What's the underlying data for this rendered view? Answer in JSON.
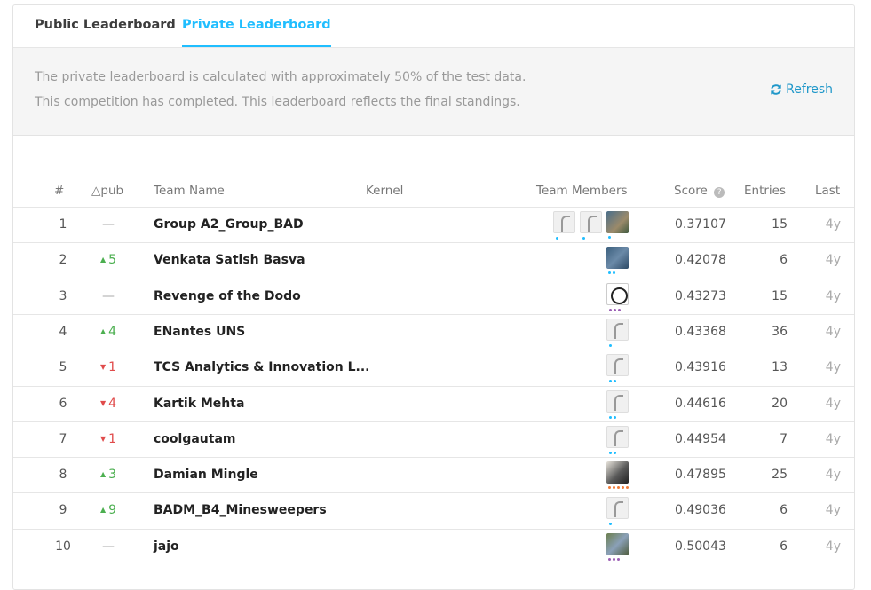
{
  "tabs": {
    "public": "Public Leaderboard",
    "private": "Private Leaderboard"
  },
  "notice": {
    "line1": "The private leaderboard is calculated with approximately 50% of the test data.",
    "line2": "This competition has completed. This leaderboard reflects the final standings.",
    "refresh": "Refresh"
  },
  "columns": {
    "rank": "#",
    "delta": "△pub",
    "team": "Team Name",
    "kernel": "Kernel",
    "members": "Team Members",
    "score": "Score",
    "entries": "Entries",
    "last": "Last"
  },
  "rows": [
    {
      "rank": "1",
      "delta": "—",
      "dir": "none",
      "team": "Group A2_Group_BAD",
      "score": "0.37107",
      "entries": "15",
      "last": "4y"
    },
    {
      "rank": "2",
      "delta": "5",
      "dir": "up",
      "team": "Venkata Satish Basva",
      "score": "0.42078",
      "entries": "6",
      "last": "4y"
    },
    {
      "rank": "3",
      "delta": "—",
      "dir": "none",
      "team": "Revenge of the Dodo",
      "score": "0.43273",
      "entries": "15",
      "last": "4y"
    },
    {
      "rank": "4",
      "delta": "4",
      "dir": "up",
      "team": "ENantes UNS",
      "score": "0.43368",
      "entries": "36",
      "last": "4y"
    },
    {
      "rank": "5",
      "delta": "1",
      "dir": "down",
      "team": "TCS Analytics & Innovation L...",
      "score": "0.43916",
      "entries": "13",
      "last": "4y"
    },
    {
      "rank": "6",
      "delta": "4",
      "dir": "down",
      "team": "Kartik Mehta",
      "score": "0.44616",
      "entries": "20",
      "last": "4y"
    },
    {
      "rank": "7",
      "delta": "1",
      "dir": "down",
      "team": "coolgautam",
      "score": "0.44954",
      "entries": "7",
      "last": "4y"
    },
    {
      "rank": "8",
      "delta": "3",
      "dir": "up",
      "team": "Damian Mingle",
      "score": "0.47895",
      "entries": "25",
      "last": "4y"
    },
    {
      "rank": "9",
      "delta": "9",
      "dir": "up",
      "team": "BADM_B4_Minesweepers",
      "score": "0.49036",
      "entries": "6",
      "last": "4y"
    },
    {
      "rank": "10",
      "delta": "—",
      "dir": "none",
      "team": "jajo",
      "score": "0.50043",
      "entries": "6",
      "last": "4y"
    }
  ],
  "colors": {
    "accent": "#20beff",
    "up": "#4caf50",
    "down": "#e04b4b"
  }
}
